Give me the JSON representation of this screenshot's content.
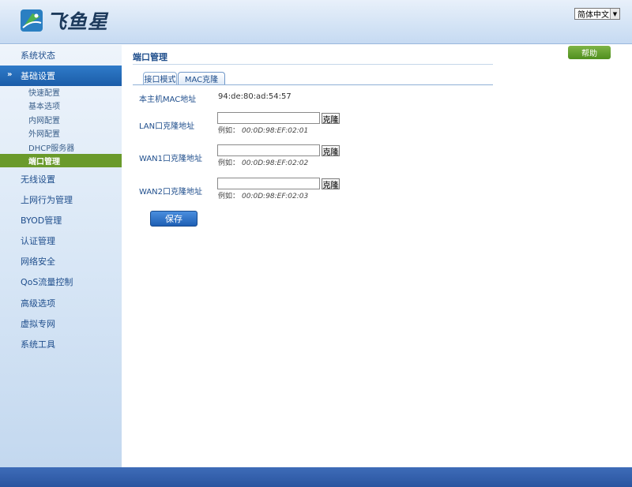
{
  "header": {
    "logo_text": "飞鱼星",
    "language": "简体中文",
    "colors": {
      "header_bg": "#d3e3f5",
      "footer_bg": "#3163af"
    }
  },
  "sidebar": {
    "items": [
      {
        "label": "系统状态"
      },
      {
        "label": "基础设置",
        "expanded": true
      },
      {
        "label": "无线设置"
      },
      {
        "label": "上网行为管理"
      },
      {
        "label": "BYOD管理"
      },
      {
        "label": "认证管理"
      },
      {
        "label": "网络安全"
      },
      {
        "label": "QoS流量控制"
      },
      {
        "label": "高级选项"
      },
      {
        "label": "虚拟专网"
      },
      {
        "label": "系统工具"
      }
    ],
    "sub_items": [
      {
        "label": "快速配置"
      },
      {
        "label": "基本选项"
      },
      {
        "label": "内网配置"
      },
      {
        "label": "外网配置"
      },
      {
        "label": "DHCP服务器"
      },
      {
        "label": "端口管理",
        "selected": true
      }
    ],
    "colors": {
      "active_bg": "#2469b8",
      "selected_sub_bg": "#6a9a2b"
    }
  },
  "main": {
    "title": "端口管理",
    "help_label": "帮助",
    "tabs": [
      {
        "label": "接口模式"
      },
      {
        "label": "MAC克隆",
        "active": true
      }
    ],
    "host_mac": {
      "label": "本主机MAC地址",
      "value": "94:de:80:ad:54:57"
    },
    "rows": [
      {
        "label": "LAN口克隆地址",
        "value": "",
        "clone_label": "克隆",
        "example_prefix": "例如：",
        "example_value": "00:0D:98:EF:02:01"
      },
      {
        "label": "WAN1口克隆地址",
        "value": "",
        "clone_label": "克隆",
        "example_prefix": "例如：",
        "example_value": "00:0D:98:EF:02:02"
      },
      {
        "label": "WAN2口克隆地址",
        "value": "",
        "clone_label": "克隆",
        "example_prefix": "例如：",
        "example_value": "00:0D:98:EF:02:03"
      }
    ],
    "save_label": "保存"
  }
}
